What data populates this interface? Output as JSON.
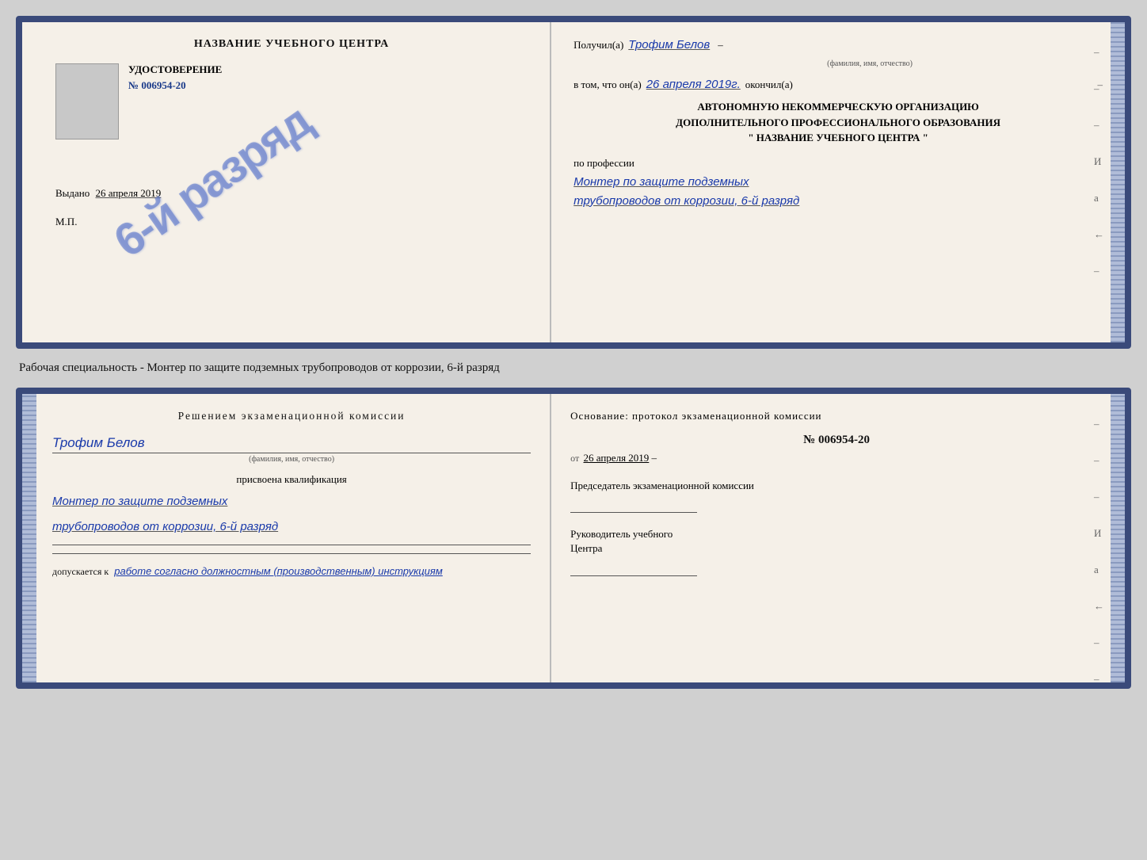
{
  "top_cert": {
    "left": {
      "title": "НАЗВАНИЕ УЧЕБНОГО ЦЕНТРА",
      "stamp_text": "6-й разряд",
      "udost_label": "УДОСТОВЕРЕНИЕ",
      "number": "№ 006954-20",
      "issued_label": "Выдано",
      "issued_date": "26 апреля 2019",
      "mp_label": "М.П."
    },
    "right": {
      "received_label": "Получил(а)",
      "person_name": "Трофим Белов",
      "name_sublabel": "(фамилия, имя, отчество)",
      "dash1": "–",
      "in_that_label": "в том, что он(а)",
      "date_handwritten": "26 апреля 2019г.",
      "finished_label": "окончил(а)",
      "dash2": "–",
      "org_line1": "АВТОНОМНУЮ НЕКОММЕРЧЕСКУЮ ОРГАНИЗАЦИЮ",
      "org_line2": "ДОПОЛНИТЕЛЬНОГО ПРОФЕССИОНАЛЬНОГО ОБРАЗОВАНИЯ",
      "org_line3": "\"   НАЗВАНИЕ УЧЕБНОГО ЦЕНТРА   \"",
      "dash3": "–",
      "dash4": "И",
      "dash5": "а",
      "dash6": "←",
      "profession_label": "по профессии",
      "profession_hw_1": "Монтер по защите подземных",
      "profession_hw_2": "трубопроводов от коррозии, 6-й разряд",
      "dash7": "–"
    }
  },
  "between_text": "Рабочая специальность - Монтер по защите подземных трубопроводов от коррозии, 6-й разряд",
  "bottom_cert": {
    "left": {
      "resolution_title": "Решением  экзаменационной  комиссии",
      "person_name": "Трофим Белов",
      "name_sublabel": "(фамилия, имя, отчество)",
      "assigned_label": "присвоена квалификация",
      "qualification_hw_1": "Монтер по защите подземных",
      "qualification_hw_2": "трубопроводов от коррозии, 6-й разряд",
      "допускается_prefix": "допускается к",
      "допускается_hw": "работе согласно должностным (производственным) инструкциям"
    },
    "right": {
      "osnov_label": "Основание:  протокол  экзаменационной  комиссии",
      "protocol_number": "№  006954-20",
      "date_prefix": "от",
      "date_value": "26 апреля 2019",
      "dash1": "–",
      "chairman_title": "Председатель экзаменационной комиссии",
      "dash2": "–",
      "dash3": "–",
      "dash4": "И",
      "dash5": "а",
      "dash6": "←",
      "director_title_1": "Руководитель учебного",
      "director_title_2": "Центра",
      "dash7": "–",
      "dash8": "–",
      "dash9": "–",
      "dash10": "–"
    }
  }
}
